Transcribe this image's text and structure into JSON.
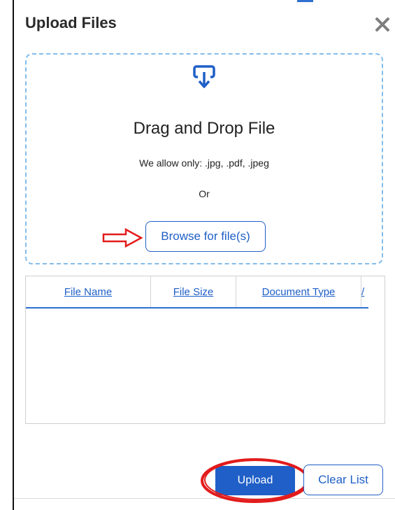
{
  "dialog": {
    "title": "Upload Files",
    "close_icon": "close-icon"
  },
  "dropzone": {
    "icon": "upload-tray-icon",
    "heading": "Drag and Drop File",
    "allowed_text": "We allow only: .jpg, .pdf, .jpeg",
    "or_text": "Or",
    "browse_label": "Browse for file(s)"
  },
  "table": {
    "columns": [
      "File Name",
      "File Size",
      "Document Type",
      "/"
    ],
    "rows": []
  },
  "actions": {
    "upload_label": "Upload",
    "clear_label": "Clear List"
  },
  "colors": {
    "accent": "#1f5fc7",
    "dropzone_border": "#84bce9",
    "annotation": "#e31b1b"
  }
}
